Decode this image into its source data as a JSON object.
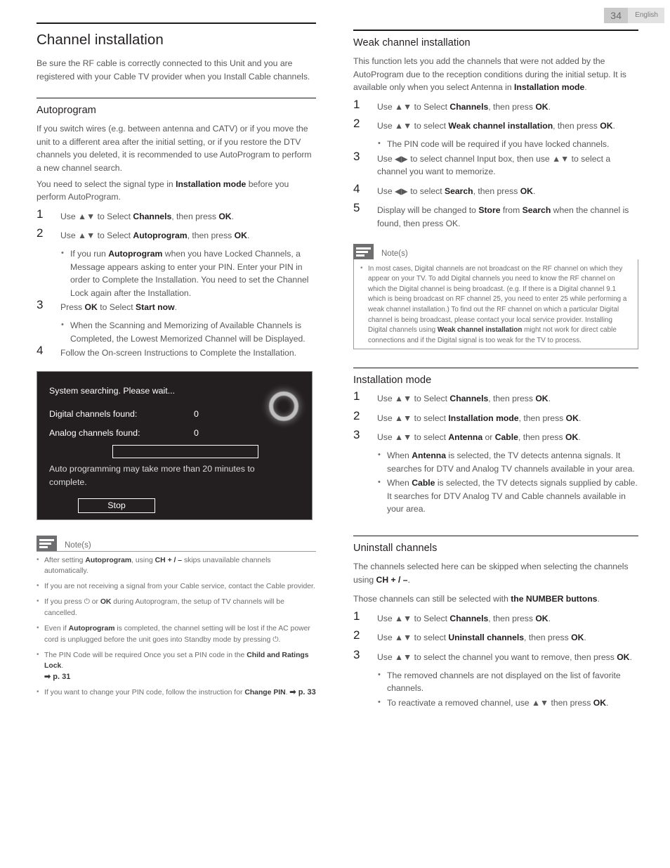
{
  "header": {
    "page_number": "34",
    "language": "English"
  },
  "left": {
    "title": "Channel installation",
    "intro": "Be sure the RF cable is correctly connected to this Unit and you are registered with your Cable TV provider when you Install Cable channels.",
    "autoprogram": {
      "heading": "Autoprogram",
      "para1": "If you switch wires (e.g. between antenna and CATV) or if you move the unit to a different area after the initial setting, or if you restore the DTV channels you deleted, it is recommended to use AutoProgram to perform a new channel search.",
      "para2_a": "You need to select the signal type in ",
      "para2_b": "Installation mode",
      "para2_c": " before you perform AutoProgram.",
      "step1": {
        "num": "1",
        "a": "Use ▲▼ to Select ",
        "b": "Channels",
        "c": ", then press ",
        "d": "OK",
        "e": "."
      },
      "step2": {
        "num": "2",
        "a": "Use ▲▼ to Select ",
        "b": "Autoprogram",
        "c": ", then press ",
        "d": "OK",
        "e": "."
      },
      "step2_bullet": {
        "a": "If you run ",
        "b": "Autoprogram",
        "c": " when you have Locked Channels, a Message appears asking to enter your PIN. Enter your PIN in order to Complete the Installation. You need to set the Channel Lock again after the Installation."
      },
      "step3": {
        "num": "3",
        "a": "Press ",
        "b": "OK",
        "c": " to Select ",
        "d": "Start now",
        "e": "."
      },
      "step3_bullet": "When the Scanning and Memorizing of Available Channels is Completed, the Lowest Memorized Channel will be Displayed.",
      "step4": {
        "num": "4",
        "text": "Follow the On-screen Instructions to Complete the Installation."
      }
    },
    "dialog": {
      "title": "System searching. Please wait...",
      "digital_label": "Digital channels found:",
      "digital_value": "0",
      "analog_label": "Analog channels found:",
      "analog_value": "0",
      "note": "Auto programming may take more than 20 minutes to complete.",
      "stop_button": "Stop"
    },
    "notes": {
      "label": "Note(s)",
      "items": [
        {
          "a": "After setting ",
          "b": "Autoprogram",
          "c": ", using ",
          "d": "CH + / –",
          "e": " skips unavailable channels automatically."
        },
        {
          "a": "If you are not receiving a signal from your Cable service, contact the Cable provider.",
          "b": "",
          "c": "",
          "d": "",
          "e": ""
        },
        {
          "a": "If you press ⏻ or ",
          "b": "OK",
          "c": " during Autoprogram, the setup of TV channels will be cancelled.",
          "d": "",
          "e": ""
        },
        {
          "a": "Even if ",
          "b": "Autoprogram",
          "c": " is completed, the channel setting will be lost if the AC power cord is unplugged before the unit goes into Standby mode by pressing ⏻.",
          "d": "",
          "e": ""
        },
        {
          "a": "The PIN Code will be required Once you set a PIN code in the ",
          "b": "Child and Ratings Lock",
          "c": ".",
          "d": "➡ p. 31",
          "e": ""
        },
        {
          "a": "If you want to change your PIN code, follow the instruction for ",
          "b": "Change PIN",
          "c": ". ",
          "d": "➡ p. 33",
          "e": ""
        }
      ]
    }
  },
  "right": {
    "weak": {
      "heading": "Weak channel installation",
      "intro_a": "This function lets you add the channels that were not added by the AutoProgram due to the reception conditions during the initial setup. It is available only when you select Antenna in ",
      "intro_b": "Installation mode",
      "intro_c": ".",
      "step1": {
        "num": "1",
        "a": "Use ▲▼ to Select ",
        "b": "Channels",
        "c": ", then press ",
        "d": "OK",
        "e": "."
      },
      "step2": {
        "num": "2",
        "a": "Use ▲▼ to select ",
        "b": "Weak channel installation",
        "c": ", then press ",
        "d": "OK",
        "e": "."
      },
      "step2_bullet": "The PIN code will be required if you have locked channels.",
      "step3": {
        "num": "3",
        "text": "Use ◀▶ to select channel Input box, then use ▲▼ to select a channel you want to memorize."
      },
      "step4": {
        "num": "4",
        "a": "Use ◀▶ to select ",
        "b": "Search",
        "c": ", then press ",
        "d": "OK",
        "e": "."
      },
      "step5": {
        "num": "5",
        "a": "Display will be changed to ",
        "b": "Store",
        "c": " from ",
        "d": "Search",
        "e": " when the channel is found, then press OK."
      }
    },
    "notes": {
      "label": "Note(s)",
      "item_a": "In most cases, Digital channels are not broadcast on the RF channel on which they appear on your TV. To add Digital channels you need to know the RF channel on which the Digital channel is being broadcast. (e.g. If there is a Digital channel 9.1 which is being broadcast on RF channel 25, you need to enter 25 while performing a weak channel installation.) To find out the RF channel on which a particular Digital channel is being broadcast, please contact your local service provider. Installing Digital channels using ",
      "item_b": "Weak channel installation",
      "item_c": " might not work for direct cable connections and if the Digital signal is too weak for the TV to process."
    },
    "install_mode": {
      "heading": "Installation mode",
      "step1": {
        "num": "1",
        "a": "Use ▲▼ to Select ",
        "b": "Channels",
        "c": ", then press ",
        "d": "OK",
        "e": "."
      },
      "step2": {
        "num": "2",
        "a": "Use ▲▼ to select ",
        "b": "Installation mode",
        "c": ", then press ",
        "d": "OK",
        "e": "."
      },
      "step3": {
        "num": "3",
        "a": "Use ▲▼ to select ",
        "b": "Antenna",
        "c": " or ",
        "d": "Cable",
        "e": ", then press ",
        "f": "OK",
        "g": "."
      },
      "bullet1_a": "When ",
      "bullet1_b": "Antenna",
      "bullet1_c": " is selected, the TV detects antenna signals. It searches for DTV and Analog TV channels available in your area.",
      "bullet2_a": "When ",
      "bullet2_b": "Cable",
      "bullet2_c": " is selected, the TV detects signals supplied by cable. It searches for DTV Analog TV and Cable channels available in your area."
    },
    "uninstall": {
      "heading": "Uninstall channels",
      "para1_a": "The channels selected here can be skipped when selecting the channels using ",
      "para1_b": "CH + / –",
      "para1_c": ".",
      "para2_a": "Those channels can still be selected with ",
      "para2_b": "the NUMBER buttons",
      "para2_c": ".",
      "step1": {
        "num": "1",
        "a": "Use ▲▼ to Select ",
        "b": "Channels",
        "c": ", then press ",
        "d": "OK",
        "e": "."
      },
      "step2": {
        "num": "2",
        "a": "Use ▲▼ to select ",
        "b": "Uninstall channels",
        "c": ", then press ",
        "d": "OK",
        "e": "."
      },
      "step3": {
        "num": "3",
        "a": "Use ▲▼ to select the channel you want to remove, then press ",
        "b": "OK",
        "c": "."
      },
      "bullet1": "The removed channels are not displayed on the list of favorite channels.",
      "bullet2_a": "To reactivate a removed channel, use ▲▼ then press ",
      "bullet2_b": "OK",
      "bullet2_c": "."
    }
  }
}
